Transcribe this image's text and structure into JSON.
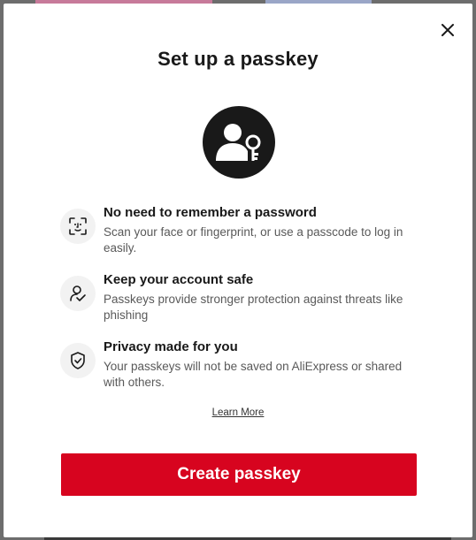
{
  "modal": {
    "title": "Set up a passkey",
    "hero_icon": "user-key-icon",
    "close_icon": "close-icon",
    "features": [
      {
        "icon": "face-scan-icon",
        "title": "No need to remember a password",
        "description": "Scan your face or fingerprint, or use a passcode to log in easily."
      },
      {
        "icon": "user-shield-icon",
        "title": "Keep your account safe",
        "description": "Passkeys provide stronger protection against threats like phishing"
      },
      {
        "icon": "shield-check-icon",
        "title": "Privacy made for you",
        "description": "Your passkeys will not be saved on AliExpress or shared with others."
      }
    ],
    "learn_more": "Learn More",
    "create_button": "Create passkey"
  },
  "colors": {
    "accent": "#d7041f",
    "title": "#191919",
    "body_text": "#595959",
    "icon_bg": "#f2f2f2"
  }
}
